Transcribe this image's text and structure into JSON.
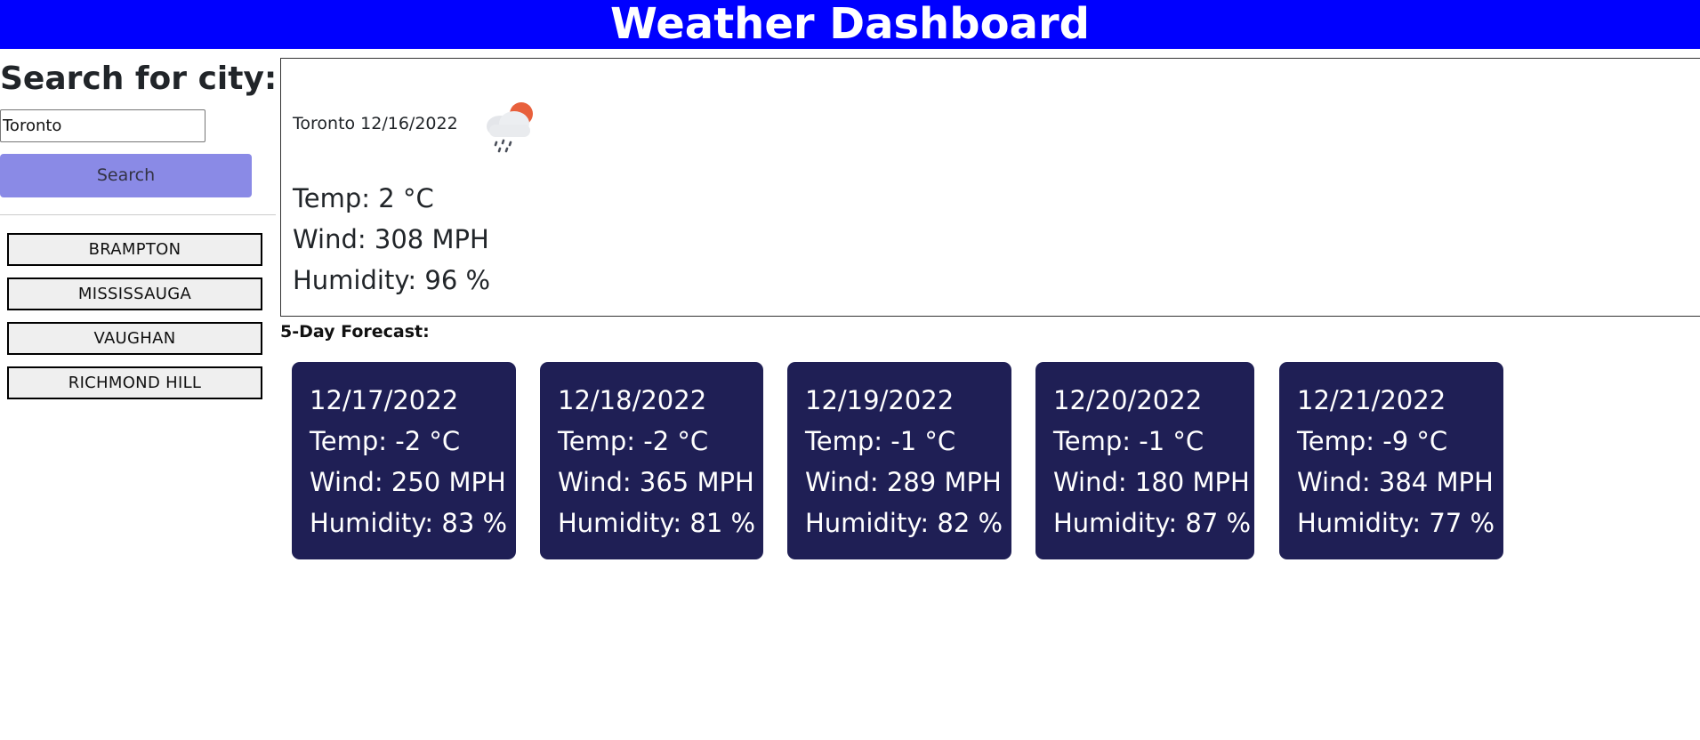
{
  "header": {
    "title": "Weather Dashboard"
  },
  "sidebar": {
    "heading": "Search for city:",
    "search_value": "Toronto",
    "search_button": "Search",
    "history": [
      "BRAMPTON",
      "MISSISSAUGA",
      "VAUGHAN",
      "RICHMOND HILL"
    ]
  },
  "current": {
    "city": "Toronto",
    "date": "12/16/2022",
    "heading": "Toronto 12/16/2022",
    "icon": "rain-cloud-sun-icon",
    "temp": "Temp: 2 °C",
    "wind": "Wind: 308 MPH",
    "humidity": "Humidity: 96 %"
  },
  "forecast": {
    "label": "5-Day Forecast:",
    "days": [
      {
        "date": "12/17/2022",
        "temp": "Temp: -2 °C",
        "wind": "Wind: 250 MPH",
        "humidity": "Humidity: 83 %"
      },
      {
        "date": "12/18/2022",
        "temp": "Temp: -2 °C",
        "wind": "Wind: 365 MPH",
        "humidity": "Humidity: 81 %"
      },
      {
        "date": "12/19/2022",
        "temp": "Temp: -1 °C",
        "wind": "Wind: 289 MPH",
        "humidity": "Humidity: 82 %"
      },
      {
        "date": "12/20/2022",
        "temp": "Temp: -1 °C",
        "wind": "Wind: 180 MPH",
        "humidity": "Humidity: 87 %"
      },
      {
        "date": "12/21/2022",
        "temp": "Temp: -9 °C",
        "wind": "Wind: 384 MPH",
        "humidity": "Humidity: 77 %"
      }
    ]
  },
  "colors": {
    "header_bg": "#0000ff",
    "search_button_bg": "#8a8ae6",
    "card_bg": "#1f1f55"
  }
}
